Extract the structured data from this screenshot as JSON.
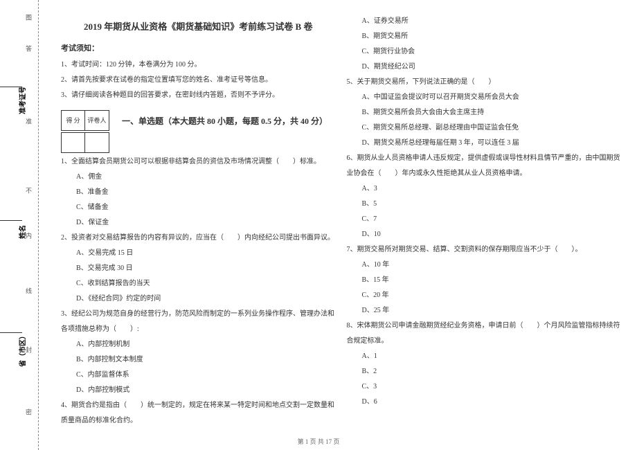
{
  "binding": {
    "seal_top": "图",
    "label_admit": "准考证号",
    "label_name": "姓名",
    "label_province": "省（市区）",
    "mark_seal": "密",
    "mark_cut": "答",
    "mark_line": "线",
    "mark_fold": "封",
    "mark_nei": "内",
    "mark_bu": "不",
    "mark_zhun": "准"
  },
  "header": {
    "title": "2019 年期货从业资格《期货基础知识》考前练习试卷 B 卷",
    "notice_title": "考试须知：",
    "notice1": "1、考试时间：120 分钟，本卷满分为 100 分。",
    "notice2": "2、请首先按要求在试卷的指定位置填写您的姓名、准考证号等信息。",
    "notice3": "3、请仔细阅读各种题目的回答要求，在密封线内答题，否则不予评分。"
  },
  "scorebox": {
    "c1": "得 分",
    "c2": "评卷人"
  },
  "section1": {
    "title": "一、单选题（本大题共 80 小题，每题 0.5 分，共 40 分）",
    "q1": "1、全面结算会员期货公司可以根据非结算会员的资信及市场情况调整（　　）标准。",
    "q1a": "A、佣金",
    "q1b": "B、准备金",
    "q1c": "C、储备金",
    "q1d": "D、保证金",
    "q2": "2、投资者对交易结算报告的内容有异议的，应当在（　　）内向经纪公司提出书面异议。",
    "q2a": "A、交易完成 15 日",
    "q2b": "B、交易完成 30 日",
    "q2c": "C、收到结算报告的当天",
    "q2d": "D、《经纪合同》约定的时间",
    "q3": "3、经纪公司为规范自身的经营行为，防范风险而制定的一系列业务操作程序、管理办法和各项措施总称为（　　）:",
    "q3a": "A、内部控制机制",
    "q3b": "B、内部控制文本制度",
    "q3c": "C、内部监督体系",
    "q3d": "D、内部控制模式",
    "q4": "4、期货合约是指由（　　）统一制定的，规定在将来某一特定时间和地点交割一定数量和质量商品的标准化合约。"
  },
  "col2": {
    "q4a": "A、证券交易所",
    "q4b": "B、期货交易所",
    "q4c": "C、期货行业协会",
    "q4d": "D、期货经纪公司",
    "q5": "5、关于期货交易所，下列说法正确的是（　　）",
    "q5a": "A、中国证监会提议时可以召开期货交易所会员大会",
    "q5b": "B、期货交易所会员大会由大会主席主持",
    "q5c": "C、期货交易所总经理、副总经理由中国证监会任免",
    "q5d": "D、期货交易所总经理每届任期 3 年，可以连任 3 届",
    "q6": "6、期货从业人员资格申请人违反规定，提供虚假或误导性材料且情节严重的，由中国期货业协会在（　　）年内或永久性拒绝其从业人员资格申请。",
    "q6a": "A、3",
    "q6b": "B、5",
    "q6c": "C、7",
    "q6d": "D、10",
    "q7": "7、期货交易所对期货交易、结算、交割资料的保存期限应当不少于（　　）。",
    "q7a": "A、10 年",
    "q7b": "B、15 年",
    "q7c": "C、20 年",
    "q7d": "D、25 年",
    "q8": "8、宋体期货公司申请金融期货经纪业务资格，申请日前（　　）个月风险监管指标持续符合规定标准。",
    "q8a": "A、1",
    "q8b": "B、2",
    "q8c": "C、3",
    "q8d": "D、6"
  },
  "footer": "第 1 页 共 17 页"
}
